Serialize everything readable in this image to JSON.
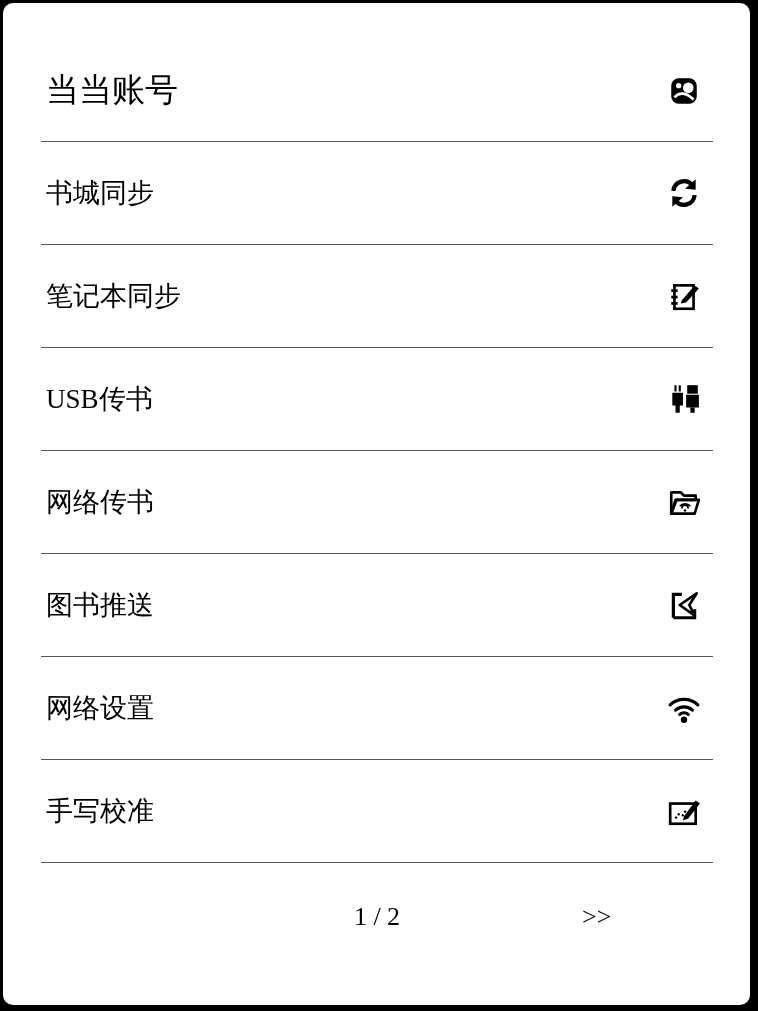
{
  "header": {
    "title": "当当账号"
  },
  "items": [
    {
      "label": "书城同步"
    },
    {
      "label": "笔记本同步"
    },
    {
      "label": "USB传书"
    },
    {
      "label": "网络传书"
    },
    {
      "label": "图书推送"
    },
    {
      "label": "网络设置"
    },
    {
      "label": "手写校准"
    }
  ],
  "pager": {
    "page": "1 / 2",
    "next": ">>"
  }
}
